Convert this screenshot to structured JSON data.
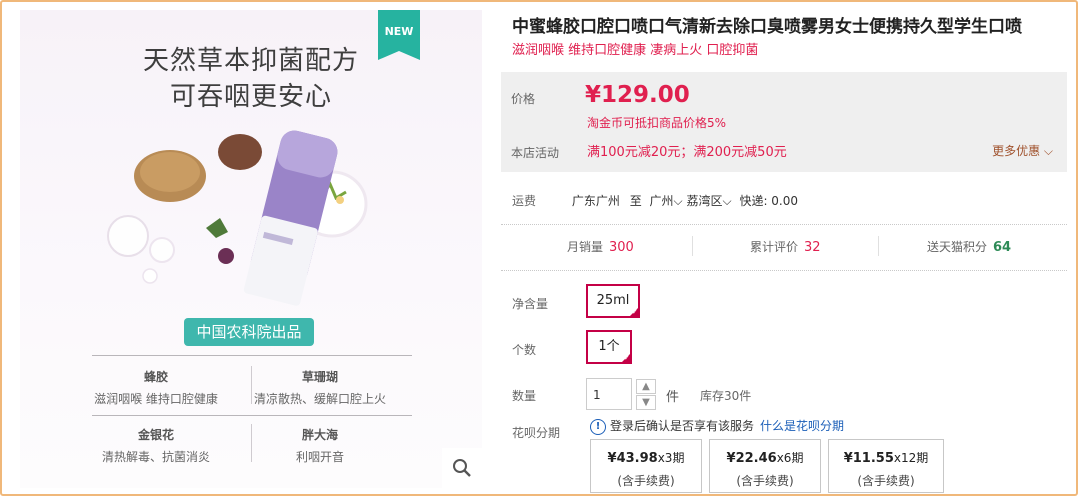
{
  "image_panel": {
    "badge": "NEW",
    "headline_1": "天然草本抑菌配方",
    "headline_2": "可吞咽更安心",
    "brand_tag": "中国农科院出品",
    "features": [
      {
        "title": "蜂胶",
        "desc": "滋润咽喉 维持口腔健康"
      },
      {
        "title": "草珊瑚",
        "desc": "清凉散热、缓解口腔上火"
      },
      {
        "title": "金银花",
        "desc": "清热解毒、抗菌消炎"
      },
      {
        "title": "胖大海",
        "desc": "利咽开音"
      }
    ],
    "zoom_icon": "search-icon"
  },
  "product": {
    "title": "中蜜蜂胶口腔口喷口气清新去除口臭喷雾男女士便携持久型学生口喷",
    "subtitle": "滋润咽喉 维持口腔健康 凄病上火 口腔抑菌"
  },
  "price_box": {
    "price_label": "价格",
    "price": "¥129.00",
    "coin_note": "淘金币可抵扣商品价格5%",
    "promo_label": "本店活动",
    "promo": "满100元减20元；满200元减50元",
    "more_label": "更多优惠"
  },
  "shipping": {
    "label": "运费",
    "from": "广东广州",
    "to_word": "至",
    "city": "广州",
    "district": "荔湾区",
    "express": "快递: 0.00"
  },
  "stats": [
    {
      "label": "月销量",
      "value": "300"
    },
    {
      "label": "累计评价",
      "value": "32"
    },
    {
      "label": "送天猫积分",
      "value": "64"
    }
  ],
  "options": {
    "volume_label": "净含量",
    "volume_value": "25ml",
    "count_label": "个数",
    "count_value": "1个"
  },
  "quantity": {
    "label": "数量",
    "value": "1",
    "unit": "件",
    "stock": "库存30件"
  },
  "huabei": {
    "label": "花呗分期",
    "note": "登录后确认是否享有该服务",
    "link": "什么是花呗分期",
    "plans": [
      {
        "amount": "¥43.98",
        "periods": "x3期",
        "fee": "(含手续费)"
      },
      {
        "amount": "¥22.46",
        "periods": "x6期",
        "fee": "(含手续费)"
      },
      {
        "amount": "¥11.55",
        "periods": "x12期",
        "fee": "(含手续费)"
      }
    ]
  },
  "colors": {
    "accent": "#e0204f",
    "selected_border": "#c40046",
    "teal": "#3fb7ad",
    "frame": "#f0b87a"
  }
}
